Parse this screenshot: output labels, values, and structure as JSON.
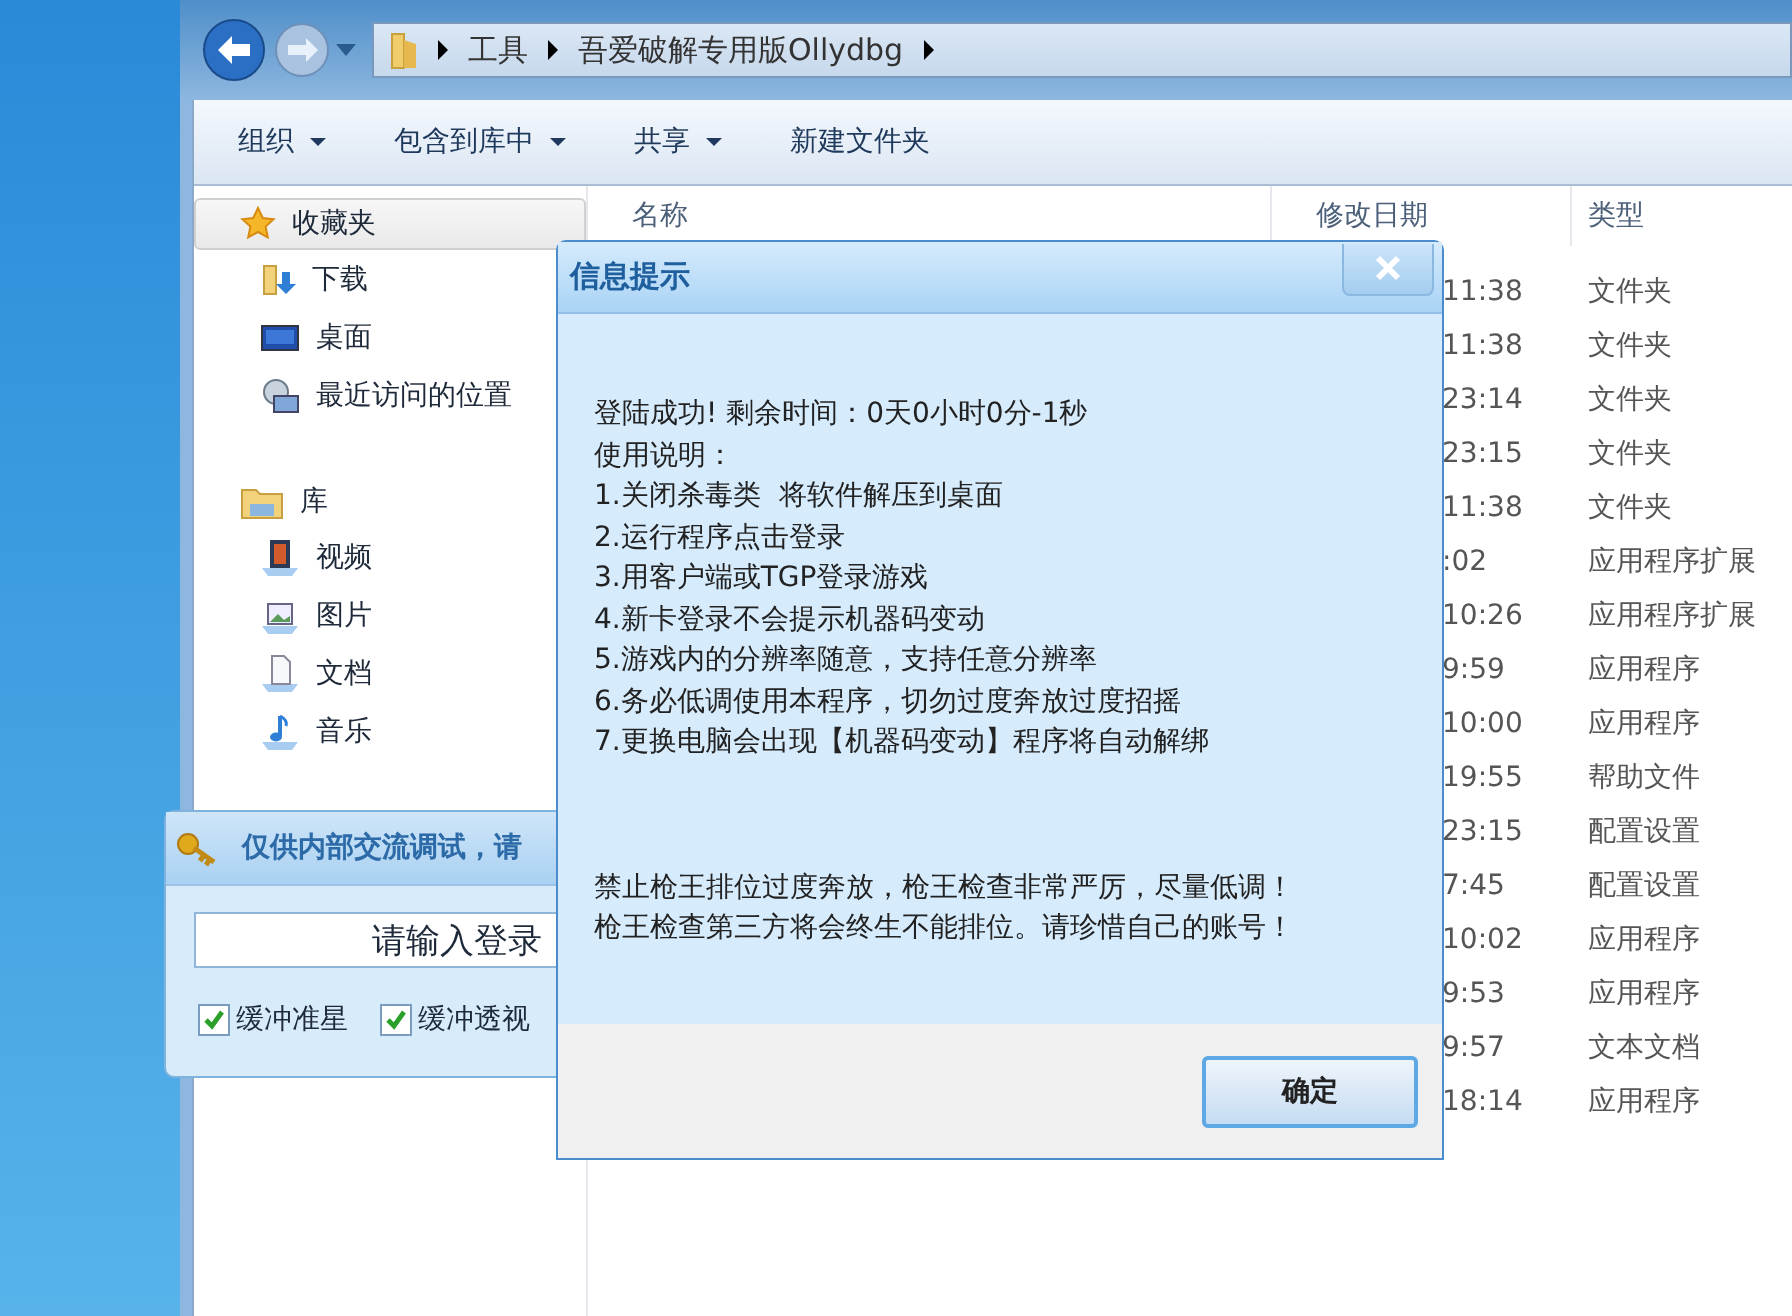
{
  "explorer": {
    "breadcrumb": [
      "工具",
      "吾爱破解专用版Ollydbg"
    ],
    "toolbar": [
      {
        "label": "组织",
        "dropdown": true
      },
      {
        "label": "包含到库中",
        "dropdown": true
      },
      {
        "label": "共享",
        "dropdown": true
      },
      {
        "label": "新建文件夹",
        "dropdown": false
      }
    ],
    "nav": [
      {
        "label": "收藏夹",
        "selected": true,
        "children": [
          {
            "label": "下载",
            "selected": false
          },
          {
            "label": "桌面",
            "selected": false
          },
          {
            "label": "最近访问的位置",
            "selected": false
          }
        ]
      },
      {
        "label": "库",
        "selected": false,
        "children": [
          {
            "label": "视频",
            "selected": false
          },
          {
            "label": "图片",
            "selected": false
          },
          {
            "label": "文档",
            "selected": false
          },
          {
            "label": "音乐",
            "selected": false
          }
        ]
      }
    ],
    "columns": [
      "名称",
      "修改日期",
      "类型"
    ],
    "rows": [
      {
        "modified": "11:38",
        "type": "文件夹"
      },
      {
        "modified": "11:38",
        "type": "文件夹"
      },
      {
        "modified": "23:14",
        "type": "文件夹"
      },
      {
        "modified": "23:15",
        "type": "文件夹"
      },
      {
        "modified": "11:38",
        "type": "文件夹"
      },
      {
        "modified": ":02",
        "type": "应用程序扩展"
      },
      {
        "modified": "10:26",
        "type": "应用程序扩展"
      },
      {
        "modified": "9:59",
        "type": "应用程序"
      },
      {
        "modified": "10:00",
        "type": "应用程序"
      },
      {
        "modified": "19:55",
        "type": "帮助文件"
      },
      {
        "modified": "23:15",
        "type": "配置设置"
      },
      {
        "modified": "7:45",
        "type": "配置设置"
      },
      {
        "modified": "10:02",
        "type": "应用程序"
      },
      {
        "modified": "9:53",
        "type": "应用程序"
      },
      {
        "modified": "9:57",
        "type": "文本文档"
      },
      {
        "modified": "18:14",
        "type": "应用程序"
      }
    ]
  },
  "login_window": {
    "title": "仅供内部交流调试，请",
    "input_value": "请输入登录",
    "checkboxes": [
      {
        "label": "缓冲准星",
        "checked": true
      },
      {
        "label": "缓冲透视",
        "checked": true
      }
    ]
  },
  "dialog": {
    "title": "信息提示",
    "lines": [
      "登陆成功! 剩余时间：0天0小时0分-1秒",
      "使用说明：",
      "1.关闭杀毒类  将软件解压到桌面",
      "2.运行程序点击登录",
      "3.用客户端或TGP登录游戏",
      "4.新卡登录不会提示机器码变动",
      "5.游戏内的分辨率随意，支持任意分辨率",
      "6.务必低调使用本程序，切勿过度奔放过度招摇",
      "7.更换电脑会出现【机器码变动】程序将自动解绑"
    ],
    "warnings": [
      "禁止枪王排位过度奔放，枪王检查非常严厉，尽量低调！",
      "枪王检查第三方将会终生不能排位。请珍惜自己的账号！"
    ],
    "button": "确定"
  }
}
